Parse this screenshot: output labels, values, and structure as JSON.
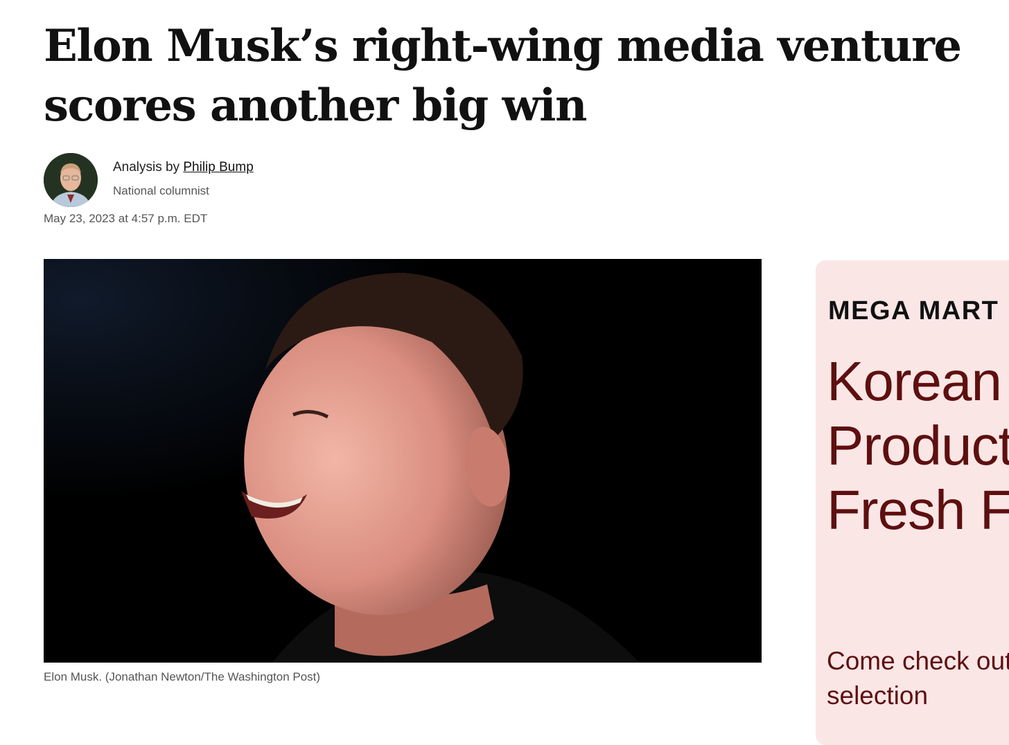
{
  "article": {
    "headline": "Elon Musk’s right-wing media venture scores another big win",
    "byline_prefix": "Analysis by ",
    "author": "Philip Bump",
    "author_role": "National columnist",
    "dateline": "May 23, 2023 at 4:57 p.m. EDT",
    "photo_caption": "Elon Musk. (Jonathan Newton/The Washington Post)"
  },
  "ad": {
    "brand": "MEGA MART",
    "title": "Korean Products & Fresh Food",
    "body": "Come check out our wide selection"
  },
  "colors": {
    "ad_background": "#fbe6e6",
    "ad_text": "#5e0f0f",
    "photo_background": "#000000"
  }
}
